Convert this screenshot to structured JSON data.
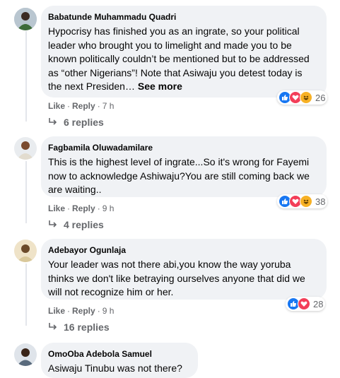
{
  "comments": [
    {
      "author": "Babatunde Muhammadu Quadri",
      "text": "Hypocrisy has finished you as an ingrate, so your political leader who brought you to limelight and made you to be known politically couldn’t be mentioned but to be addressed as “other Nigerians”! Note that Asiwaju you detest today is the next Presiden…",
      "see_more": "See more",
      "like": "Like",
      "reply": "Reply",
      "time": "7 h",
      "reaction_icons": [
        "like-icon",
        "love-icon",
        "haha-icon"
      ],
      "reaction_count": "26",
      "replies": "6 replies"
    },
    {
      "author": "Fagbamila Oluwadamilare",
      "text": "This is the highest level of ingrate...So it's wrong for Fayemi now to acknowledge Ashiwaju?You are still coming back we are waiting..",
      "like": "Like",
      "reply": "Reply",
      "time": "9 h",
      "reaction_icons": [
        "like-icon",
        "love-icon",
        "haha-icon"
      ],
      "reaction_count": "38",
      "replies": "4 replies"
    },
    {
      "author": "Adebayor Ogunlaja",
      "text": "Your leader was not there abi,you know the way yoruba thinks we don't like betraying ourselves anyone that did we will not recognize him or her.",
      "like": "Like",
      "reply": "Reply",
      "time": "9 h",
      "reaction_icons": [
        "like-icon",
        "love-icon"
      ],
      "reaction_count": "28",
      "replies": "16 replies"
    },
    {
      "author": "OmoOba Adebola Samuel",
      "text": "Asiwaju Tinubu was not there?"
    }
  ],
  "colors": {
    "like": "#1877f2",
    "love": "#f33e58",
    "haha": "#f7b125",
    "bubble": "#f0f2f5",
    "meta": "#65676b"
  }
}
